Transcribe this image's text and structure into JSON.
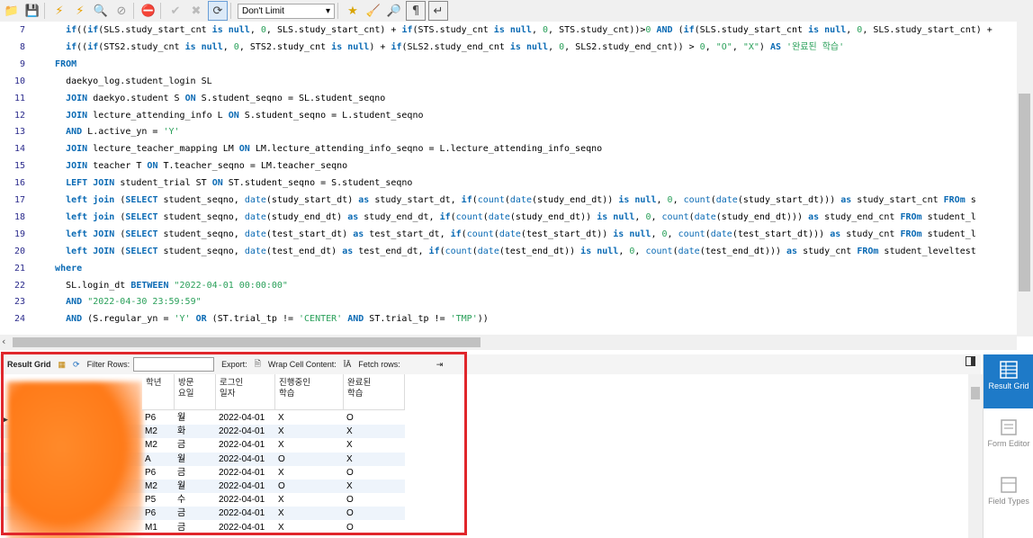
{
  "toolbar": {
    "limit_value": "Don't Limit",
    "icons": [
      "folder-icon",
      "save-icon",
      "lightning-icon",
      "lightning-cursor-icon",
      "magnifier-icon",
      "stop-icon",
      "toggle-error-icon",
      "commit-icon",
      "rollback-icon",
      "autocommit-icon",
      "star-icon",
      "broom-icon",
      "search-icon",
      "pilcrow-icon",
      "wrap-icon"
    ]
  },
  "editor": {
    "lines": [
      {
        "n": "7",
        "t": "    if((if(SLS.study_start_cnt is null, 0, SLS.study_start_cnt) + if(STS.study_cnt is null, 0, STS.study_cnt))>0 AND (if(SLS.study_start_cnt is null, 0, SLS.study_start_cnt) +"
      },
      {
        "n": "8",
        "t": "    if((if(STS2.study_cnt is null, 0, STS2.study_cnt is null) + if(SLS2.study_end_cnt is null, 0, SLS2.study_end_cnt)) > 0, \"O\", \"X\") AS '완료된 학습'"
      },
      {
        "n": "9",
        "t": "  FROM"
      },
      {
        "n": "10",
        "t": "    daekyo_log.student_login SL"
      },
      {
        "n": "11",
        "t": "    JOIN daekyo.student S ON S.student_seqno = SL.student_seqno"
      },
      {
        "n": "12",
        "t": "    JOIN lecture_attending_info L ON S.student_seqno = L.student_seqno"
      },
      {
        "n": "13",
        "t": "    AND L.active_yn = 'Y'"
      },
      {
        "n": "14",
        "t": "    JOIN lecture_teacher_mapping LM ON LM.lecture_attending_info_seqno = L.lecture_attending_info_seqno"
      },
      {
        "n": "15",
        "t": "    JOIN teacher T ON T.teacher_seqno = LM.teacher_seqno"
      },
      {
        "n": "16",
        "t": "    LEFT JOIN student_trial ST ON ST.student_seqno = S.student_seqno"
      },
      {
        "n": "17",
        "t": "    left join (SELECT student_seqno, date(study_start_dt) as study_start_dt, if(count(date(study_end_dt)) is null, 0, count(date(study_start_dt))) as study_start_cnt FROm s"
      },
      {
        "n": "18",
        "t": "    left join (SELECT student_seqno, date(study_end_dt) as study_end_dt, if(count(date(study_end_dt)) is null, 0, count(date(study_end_dt))) as study_end_cnt FROm student_l"
      },
      {
        "n": "19",
        "t": "    left JOIN (SELECT student_seqno, date(test_start_dt) as test_start_dt, if(count(date(test_start_dt)) is null, 0, count(date(test_start_dt))) as study_cnt FROm student_l"
      },
      {
        "n": "20",
        "t": "    left JOIN (SELECT student_seqno, date(test_end_dt) as test_end_dt, if(count(date(test_end_dt)) is null, 0, count(date(test_end_dt))) as study_cnt FROm student_leveltest"
      },
      {
        "n": "21",
        "t": "  where"
      },
      {
        "n": "22",
        "t": "    SL.login_dt BETWEEN \"2022-04-01 00:00:00\""
      },
      {
        "n": "23",
        "t": "    AND \"2022-04-30 23:59:59\""
      },
      {
        "n": "24",
        "t": "    AND (S.regular_yn = 'Y' OR (ST.trial_tp != 'CENTER' AND ST.trial_tp != 'TMP'))"
      }
    ]
  },
  "result_toolbar": {
    "result_grid": "Result Grid",
    "filter_rows": "Filter Rows:",
    "export": "Export:",
    "wrap": "Wrap Cell Content:",
    "fetch": "Fetch rows:"
  },
  "grid": {
    "headers": [
      "학년",
      "방문\n요일",
      "로그인\n일자",
      "진행중인\n학습",
      "완료된\n학습"
    ],
    "rows": [
      [
        "P6",
        "월",
        "2022-04-01",
        "X",
        "O"
      ],
      [
        "M2",
        "화",
        "2022-04-01",
        "X",
        "X"
      ],
      [
        "M2",
        "금",
        "2022-04-01",
        "X",
        "X"
      ],
      [
        "A",
        "월",
        "2022-04-01",
        "O",
        "X"
      ],
      [
        "P6",
        "금",
        "2022-04-01",
        "X",
        "O"
      ],
      [
        "M2",
        "월",
        "2022-04-01",
        "O",
        "X"
      ],
      [
        "P5",
        "수",
        "2022-04-01",
        "X",
        "O"
      ],
      [
        "P6",
        "금",
        "2022-04-01",
        "X",
        "O"
      ],
      [
        "M1",
        "금",
        "2022-04-01",
        "X",
        "O"
      ]
    ]
  },
  "side_panel": {
    "items": [
      "Result Grid",
      "Form Editor",
      "Field Types"
    ]
  }
}
